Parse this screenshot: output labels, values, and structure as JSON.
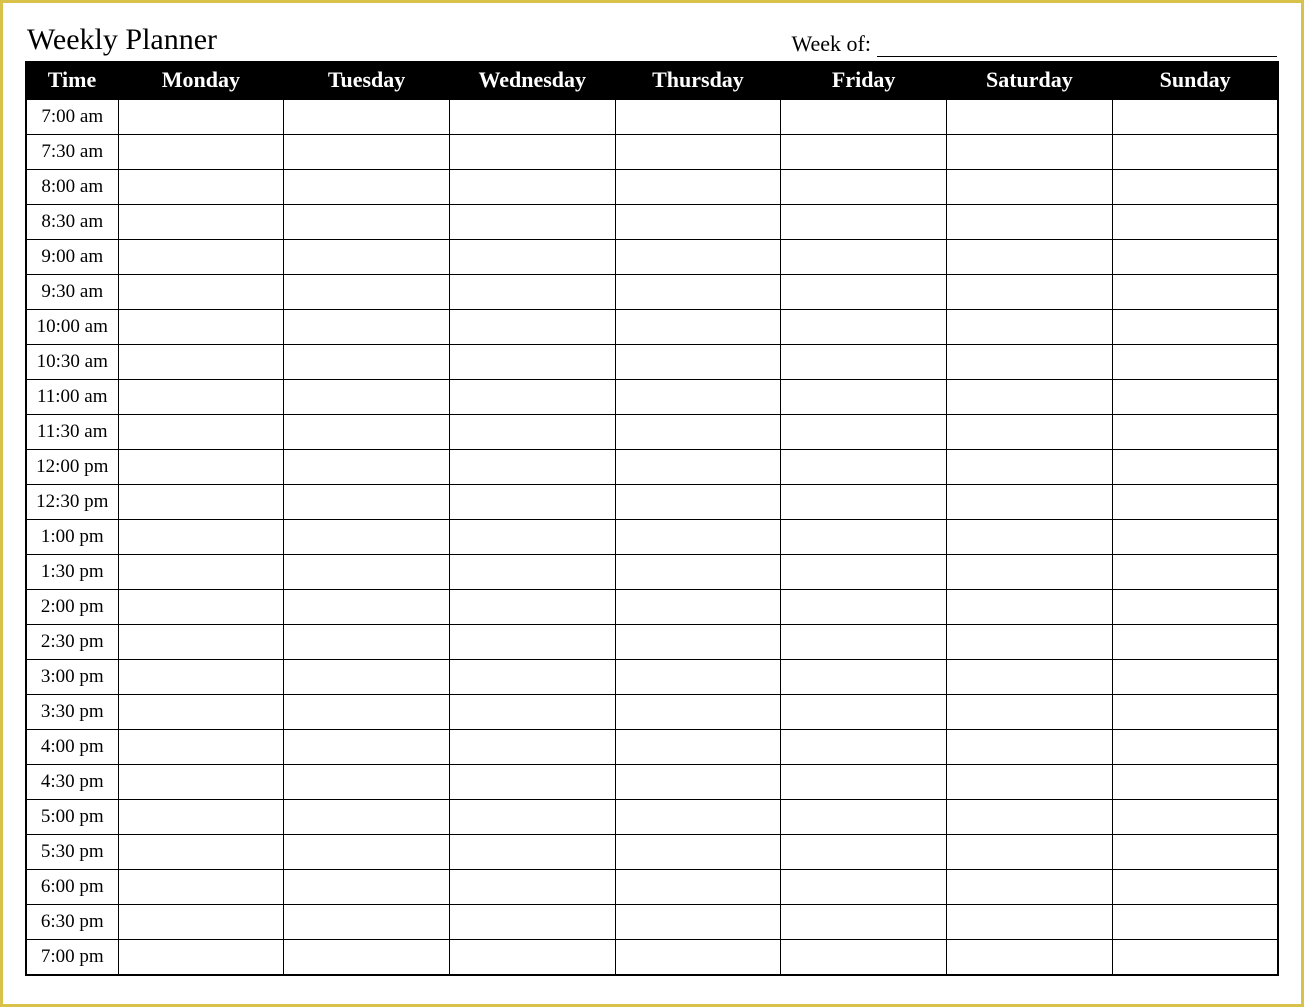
{
  "header": {
    "title": "Weekly Planner",
    "week_of_label": "Week of:",
    "week_of_value": ""
  },
  "columns": {
    "time": "Time",
    "days": [
      "Monday",
      "Tuesday",
      "Wednesday",
      "Thursday",
      "Friday",
      "Saturday",
      "Sunday"
    ]
  },
  "rows": [
    {
      "time": "7:00 am",
      "cells": [
        "",
        "",
        "",
        "",
        "",
        "",
        ""
      ]
    },
    {
      "time": "7:30 am",
      "cells": [
        "",
        "",
        "",
        "",
        "",
        "",
        ""
      ]
    },
    {
      "time": "8:00 am",
      "cells": [
        "",
        "",
        "",
        "",
        "",
        "",
        ""
      ]
    },
    {
      "time": "8:30 am",
      "cells": [
        "",
        "",
        "",
        "",
        "",
        "",
        ""
      ]
    },
    {
      "time": "9:00 am",
      "cells": [
        "",
        "",
        "",
        "",
        "",
        "",
        ""
      ]
    },
    {
      "time": "9:30 am",
      "cells": [
        "",
        "",
        "",
        "",
        "",
        "",
        ""
      ]
    },
    {
      "time": "10:00 am",
      "cells": [
        "",
        "",
        "",
        "",
        "",
        "",
        ""
      ]
    },
    {
      "time": "10:30 am",
      "cells": [
        "",
        "",
        "",
        "",
        "",
        "",
        ""
      ]
    },
    {
      "time": "11:00 am",
      "cells": [
        "",
        "",
        "",
        "",
        "",
        "",
        ""
      ]
    },
    {
      "time": "11:30 am",
      "cells": [
        "",
        "",
        "",
        "",
        "",
        "",
        ""
      ]
    },
    {
      "time": "12:00 pm",
      "cells": [
        "",
        "",
        "",
        "",
        "",
        "",
        ""
      ]
    },
    {
      "time": "12:30 pm",
      "cells": [
        "",
        "",
        "",
        "",
        "",
        "",
        ""
      ]
    },
    {
      "time": "1:00 pm",
      "cells": [
        "",
        "",
        "",
        "",
        "",
        "",
        ""
      ]
    },
    {
      "time": "1:30 pm",
      "cells": [
        "",
        "",
        "",
        "",
        "",
        "",
        ""
      ]
    },
    {
      "time": "2:00 pm",
      "cells": [
        "",
        "",
        "",
        "",
        "",
        "",
        ""
      ]
    },
    {
      "time": "2:30 pm",
      "cells": [
        "",
        "",
        "",
        "",
        "",
        "",
        ""
      ]
    },
    {
      "time": "3:00 pm",
      "cells": [
        "",
        "",
        "",
        "",
        "",
        "",
        ""
      ]
    },
    {
      "time": "3:30 pm",
      "cells": [
        "",
        "",
        "",
        "",
        "",
        "",
        ""
      ]
    },
    {
      "time": "4:00 pm",
      "cells": [
        "",
        "",
        "",
        "",
        "",
        "",
        ""
      ]
    },
    {
      "time": "4:30 pm",
      "cells": [
        "",
        "",
        "",
        "",
        "",
        "",
        ""
      ]
    },
    {
      "time": "5:00 pm",
      "cells": [
        "",
        "",
        "",
        "",
        "",
        "",
        ""
      ]
    },
    {
      "time": "5:30 pm",
      "cells": [
        "",
        "",
        "",
        "",
        "",
        "",
        ""
      ]
    },
    {
      "time": "6:00 pm",
      "cells": [
        "",
        "",
        "",
        "",
        "",
        "",
        ""
      ]
    },
    {
      "time": "6:30 pm",
      "cells": [
        "",
        "",
        "",
        "",
        "",
        "",
        ""
      ]
    },
    {
      "time": "7:00 pm",
      "cells": [
        "",
        "",
        "",
        "",
        "",
        "",
        ""
      ]
    }
  ]
}
